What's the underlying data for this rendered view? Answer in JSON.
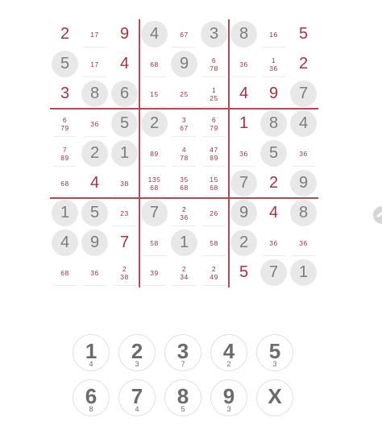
{
  "grid": [
    [
      {
        "v": "2",
        "t": "entered"
      },
      {
        "p": "17"
      },
      {
        "v": "9",
        "t": "entered"
      },
      {
        "v": "4",
        "t": "given"
      },
      {
        "p": "67"
      },
      {
        "v": "3",
        "t": "given"
      },
      {
        "v": "8",
        "t": "given"
      },
      {
        "p": "16"
      },
      {
        "v": "5",
        "t": "entered"
      }
    ],
    [
      {
        "v": "5",
        "t": "given"
      },
      {
        "p": "17"
      },
      {
        "v": "4",
        "t": "entered"
      },
      {
        "p": "68"
      },
      {
        "v": "9",
        "t": "given"
      },
      {
        "p": "6\n78"
      },
      {
        "p": "36"
      },
      {
        "p": "1\n36"
      },
      {
        "v": "2",
        "t": "entered"
      }
    ],
    [
      {
        "v": "3",
        "t": "entered"
      },
      {
        "v": "8",
        "t": "given"
      },
      {
        "v": "6",
        "t": "given"
      },
      {
        "p": "15"
      },
      {
        "p": "25"
      },
      {
        "p": "1\n25"
      },
      {
        "v": "4",
        "t": "entered"
      },
      {
        "v": "9",
        "t": "entered"
      },
      {
        "v": "7",
        "t": "given"
      }
    ],
    [
      {
        "p": "6\n79"
      },
      {
        "p": "36"
      },
      {
        "v": "5",
        "t": "given"
      },
      {
        "v": "2",
        "t": "given"
      },
      {
        "p": "3\n67"
      },
      {
        "p": "6\n79"
      },
      {
        "v": "1",
        "t": "entered"
      },
      {
        "v": "8",
        "t": "given"
      },
      {
        "v": "4",
        "t": "given"
      }
    ],
    [
      {
        "p": "7\n89"
      },
      {
        "v": "2",
        "t": "given"
      },
      {
        "v": "1",
        "t": "given"
      },
      {
        "p": "89"
      },
      {
        "p": "4\n78"
      },
      {
        "p": "47\n89"
      },
      {
        "p": "36"
      },
      {
        "v": "5",
        "t": "given"
      },
      {
        "p": "36"
      }
    ],
    [
      {
        "p": "68"
      },
      {
        "v": "4",
        "t": "entered"
      },
      {
        "p": "38"
      },
      {
        "p": "135\n68"
      },
      {
        "p": "35\n68"
      },
      {
        "p": "15\n68"
      },
      {
        "v": "7",
        "t": "given"
      },
      {
        "v": "2",
        "t": "entered"
      },
      {
        "v": "9",
        "t": "given"
      }
    ],
    [
      {
        "v": "1",
        "t": "given"
      },
      {
        "v": "5",
        "t": "given"
      },
      {
        "p": "23"
      },
      {
        "v": "7",
        "t": "given"
      },
      {
        "p": "2\n36"
      },
      {
        "p": "26"
      },
      {
        "v": "9",
        "t": "given"
      },
      {
        "v": "4",
        "t": "entered"
      },
      {
        "v": "8",
        "t": "given"
      }
    ],
    [
      {
        "v": "4",
        "t": "given"
      },
      {
        "v": "9",
        "t": "given"
      },
      {
        "v": "7",
        "t": "entered"
      },
      {
        "p": "58"
      },
      {
        "v": "1",
        "t": "given"
      },
      {
        "p": "58"
      },
      {
        "v": "2",
        "t": "given"
      },
      {
        "p": "36"
      },
      {
        "p": "36"
      }
    ],
    [
      {
        "p": "68"
      },
      {
        "p": "36"
      },
      {
        "p": "2\n38"
      },
      {
        "p": "39"
      },
      {
        "p": "2\n34"
      },
      {
        "p": "2\n49"
      },
      {
        "v": "5",
        "t": "entered"
      },
      {
        "v": "7",
        "t": "given"
      },
      {
        "v": "1",
        "t": "given"
      }
    ]
  ],
  "keypad": [
    {
      "digit": "1",
      "count": "4"
    },
    {
      "digit": "2",
      "count": "3"
    },
    {
      "digit": "3",
      "count": "7"
    },
    {
      "digit": "4",
      "count": "2"
    },
    {
      "digit": "5",
      "count": "3"
    },
    {
      "digit": "6",
      "count": "8"
    },
    {
      "digit": "7",
      "count": "4"
    },
    {
      "digit": "8",
      "count": "5"
    },
    {
      "digit": "9",
      "count": "3"
    },
    {
      "digit": "X",
      "count": ""
    }
  ],
  "colors": {
    "given_bg": "#e8e8e8",
    "entered_text": "#a8323f",
    "grid_line": "#b54a56",
    "pencil": "#8a3a44"
  }
}
